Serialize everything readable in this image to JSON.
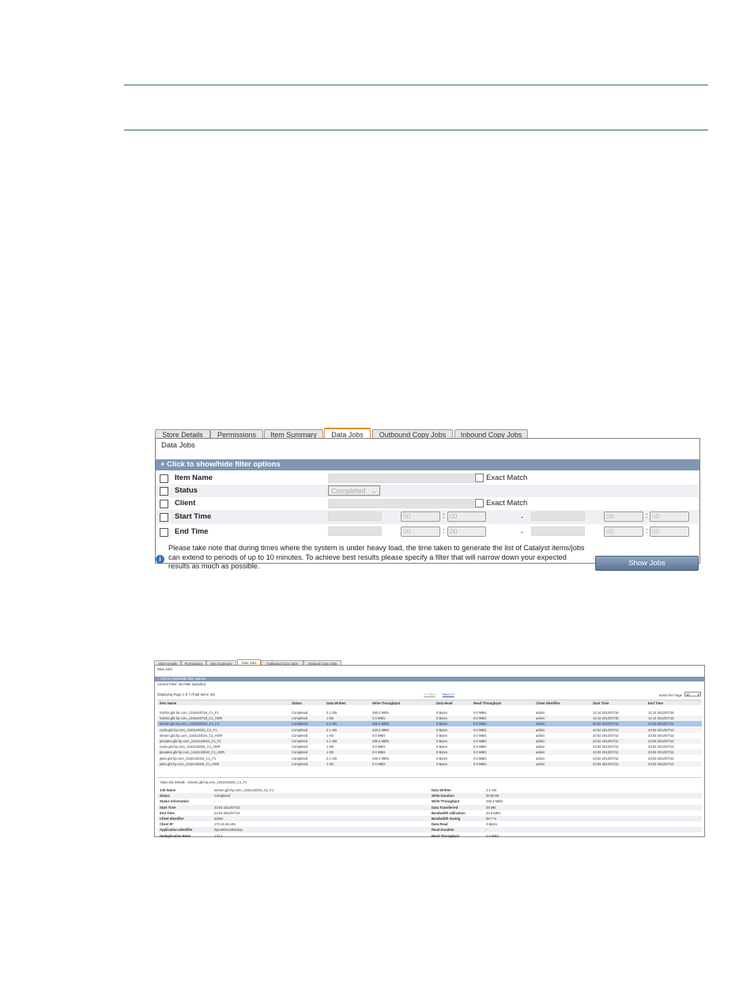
{
  "s1": {
    "tabs": [
      "Store Details",
      "Permissions",
      "Item Summary",
      "Data Jobs",
      "Outbound Copy Jobs",
      "Inbound Copy Jobs"
    ],
    "active_tab": "Data Jobs",
    "panel_title": "Data Jobs",
    "filter_toggle": "+ Click to show/hide filter options",
    "filters": {
      "item_name": "Item Name",
      "status": "Status",
      "client": "Client",
      "start_time": "Start Time",
      "end_time": "End Time",
      "exact_match": "Exact Match",
      "status_value": "Completed",
      "time_placeholder": "00",
      "colon": ":",
      "dash": "-"
    },
    "note": "Please take note that during times where the system is under heavy load, the time taken to generate the list of Catalyst items/jobs can extend to periods of up to 10 minutes. To achieve best results please specify a filter that will narrow down your expected results as much as possible.",
    "info_icon": "i",
    "show_jobs": "Show Jobs"
  },
  "s2": {
    "tabs": [
      "Store Details",
      "Permissions",
      "Item Summary",
      "Data Jobs",
      "Outbound Copy Jobs",
      "Inbound Copy Jobs"
    ],
    "panel_title": "Data Jobs",
    "filter_toggle": "+ Click to show/hide filter options",
    "current_filter": "Current Filter: No Filter Specified",
    "displaying": "Displaying Page 1 of 7 (Total Items: 66)",
    "prev": "<< Prev",
    "next": "Next >>",
    "items_per_page_label": "Items Per Page",
    "items_per_page": "10",
    "columns": [
      "Item Name",
      "Status",
      "Data Written",
      "Write Throughput",
      "Data Read",
      "Read Throughput",
      "Client Identifier",
      "Start Time",
      "End Time"
    ],
    "rows": [
      [
        "hatcha.gbr.hp.com_1342440718_C1_F1",
        "Completed",
        "2.1 GB",
        "280.2 MB/s",
        "0 Bytes",
        "0.0 MB/s",
        "admin",
        "12:14 2012/07/16",
        "12:14 2012/07/16"
      ],
      [
        "hatcha.gbr.hp.com_1342440718_C1_HDR",
        "Completed",
        "1 KB",
        "0.0 MB/s",
        "0 Bytes",
        "0.0 MB/s",
        "admin",
        "12:14 2012/07/16",
        "12:14 2012/07/16"
      ],
      [
        "stream.gbr.hp.com_1342134024_C1_F1",
        "Completed",
        "2.1 GB",
        "230.4 MB/s",
        "0 Bytes",
        "0.0 MB/s",
        "admin",
        "23:02 2012/07/12",
        "23:03 2012/07/12"
      ],
      [
        "ryalio.gbr.hp.com_1342134023_C1_F1",
        "Completed",
        "2.1 GB",
        "230.4 MB/s",
        "0 Bytes",
        "0.0 MB/s",
        "admin",
        "23:02 2012/07/12",
        "23:03 2012/07/12"
      ],
      [
        "stream.gbr.hp.com_1342134024_C1_HDR",
        "Completed",
        "1 KB",
        "0.0 MB/s",
        "0 Bytes",
        "0.0 MB/s",
        "admin",
        "23:02 2012/07/12",
        "23:02 2012/07/12"
      ],
      [
        "pleiades.gbr.hp.com_1342134022_C1_F1",
        "Completed",
        "2.1 GB",
        "230.4 MB/s",
        "0 Bytes",
        "0.0 MB/s",
        "admin",
        "23:02 2012/07/12",
        "23:03 2012/07/12"
      ],
      [
        "ryalio.gbr.hp.com_1342134023_C1_HDR",
        "Completed",
        "1 KB",
        "0.0 MB/s",
        "0 Bytes",
        "0.0 MB/s",
        "admin",
        "23:02 2012/07/12",
        "23:02 2012/07/12"
      ],
      [
        "pleiades.gbr.hp.com_1342134022_C1_HDR",
        "Completed",
        "1 KB",
        "0.0 MB/s",
        "0 Bytes",
        "0.0 MB/s",
        "admin",
        "23:02 2012/07/12",
        "23:02 2012/07/12"
      ],
      [
        "joker.gbr.hp.com_1342134019_C1_F1",
        "Completed",
        "2.1 GB",
        "230.4 MB/s",
        "0 Bytes",
        "0.0 MB/s",
        "admin",
        "23:02 2012/07/12",
        "23:03 2012/07/12"
      ],
      [
        "joker.gbr.hp.com_1342134019_C1_HDR",
        "Completed",
        "1 KB",
        "0.0 MB/s",
        "0 Bytes",
        "0.0 MB/s",
        "admin",
        "23:02 2012/07/12",
        "23:02 2012/07/12"
      ]
    ],
    "details_title": "Data Job Details - stream.gbr.hp.com_1342134024_C1_F1",
    "details_left": [
      [
        "Job Name",
        "stream.gbr.hp.com_1342134024_C1_F1"
      ],
      [
        "Status",
        "Completed"
      ],
      [
        "Status Information",
        "-"
      ],
      [
        "Start Time",
        "23:02 2012/07/12"
      ],
      [
        "End Time",
        "23:03 2012/07/12"
      ],
      [
        "Client Identifier",
        "admin"
      ],
      [
        "Client IP",
        "172.16.16.165"
      ],
      [
        "Application Identifier",
        "DynamicIceBackup"
      ],
      [
        "Deduplication Ratio",
        "174.2"
      ]
    ],
    "details_right": [
      [
        "Data Written",
        "2.1 GB"
      ],
      [
        "Write Duration",
        "00:00:09"
      ],
      [
        "Write Throughput",
        "230.4 MB/s"
      ],
      [
        "Data Transferred",
        "28 MB"
      ],
      [
        "Bandwidth Utilisation",
        "25.9 Mb/s"
      ],
      [
        "Bandwidth Saving",
        "98.7 %"
      ],
      [
        "Data Read",
        "0 Bytes"
      ],
      [
        "Read Duration",
        "-"
      ],
      [
        "Read Throughput",
        "0.0 MB/s"
      ]
    ]
  }
}
